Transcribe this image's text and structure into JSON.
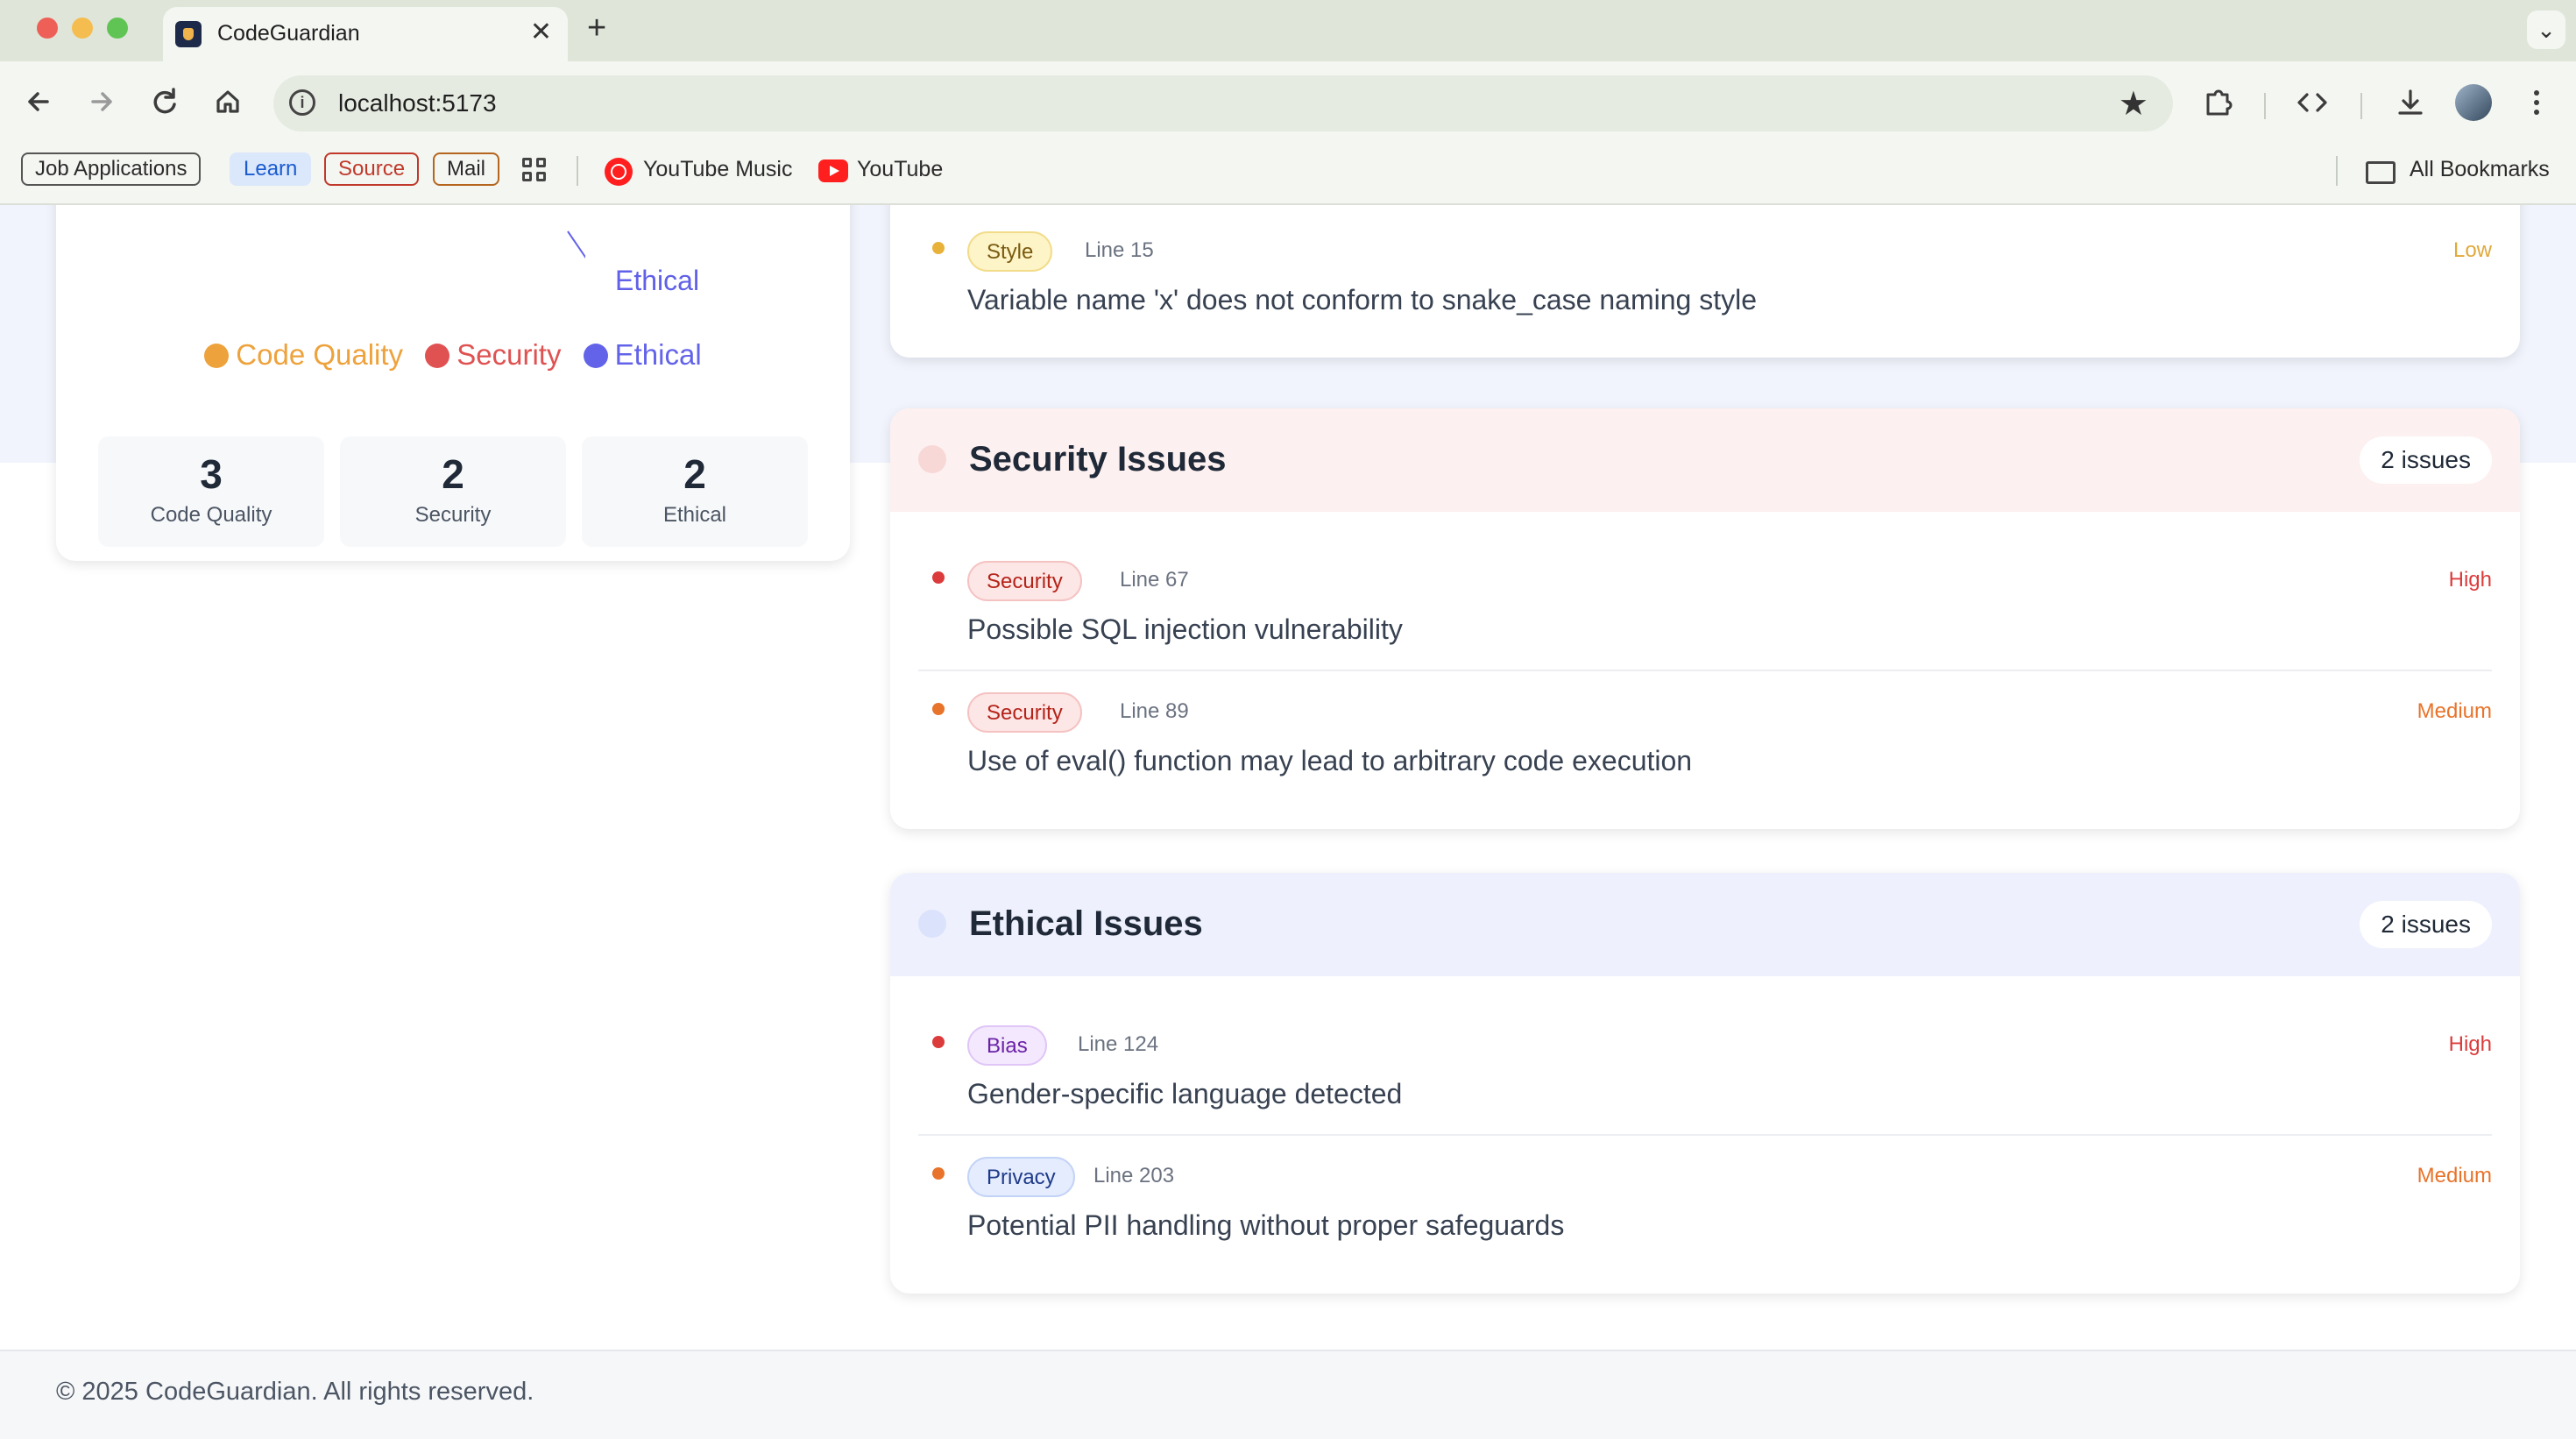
{
  "browser": {
    "tab_title": "CodeGuardian",
    "tab_close": "✕",
    "new_tab": "+",
    "tab_menu": "⌄",
    "url": "localhost:5173",
    "bookmarks": {
      "job_applications": "Job Applications",
      "learn": "Learn",
      "source": "Source",
      "mail": "Mail",
      "youtube_music": "YouTube Music",
      "youtube": "YouTube",
      "all_bookmarks": "All Bookmarks"
    }
  },
  "summary": {
    "chart_data": {
      "type": "pie",
      "categories": [
        "Code Quality",
        "Security",
        "Ethical"
      ],
      "values": [
        3,
        2,
        2
      ],
      "colors": [
        "#eea23c",
        "#e05252",
        "#6363ea"
      ],
      "visible_slice_label": "Ethical"
    },
    "legend": [
      {
        "label": "Code Quality",
        "color": "#eea23c"
      },
      {
        "label": "Security",
        "color": "#e05252"
      },
      {
        "label": "Ethical",
        "color": "#6363ea"
      }
    ],
    "stats": [
      {
        "value": "3",
        "label": "Code Quality"
      },
      {
        "value": "2",
        "label": "Security"
      },
      {
        "value": "2",
        "label": "Ethical"
      }
    ]
  },
  "code_quality_partial": {
    "issue": {
      "tag": "Style",
      "line": "Line 15",
      "severity": "Low",
      "severity_color": "#e0a93a",
      "dot_color": "#e8b23a",
      "text": "Variable name 'x' does not conform to snake_case naming style"
    }
  },
  "security_section": {
    "title": "Security Issues",
    "count": "2 issues",
    "header_bg": "#fdf0f0",
    "header_dot": "#f8d7d7",
    "issues": [
      {
        "tag": "Security",
        "line": "Line 67",
        "severity": "High",
        "severity_color": "#dc3b3b",
        "dot_color": "#dc3b3b",
        "text": "Possible SQL injection vulnerability"
      },
      {
        "tag": "Security",
        "line": "Line 89",
        "severity": "Medium",
        "severity_color": "#e8732a",
        "dot_color": "#e8732a",
        "text": "Use of eval() function may lead to arbitrary code execution"
      }
    ]
  },
  "ethical_section": {
    "title": "Ethical Issues",
    "count": "2 issues",
    "header_bg": "#eef1fd",
    "header_dot": "#dbe2fb",
    "issues": [
      {
        "tag": "Bias",
        "line": "Line 124",
        "severity": "High",
        "severity_color": "#dc3b3b",
        "dot_color": "#dc3b3b",
        "text": "Gender-specific language detected"
      },
      {
        "tag": "Privacy",
        "line": "Line 203",
        "severity": "Medium",
        "severity_color": "#e8732a",
        "dot_color": "#e8732a",
        "text": "Potential PII handling without proper safeguards"
      }
    ]
  },
  "footer": {
    "text": "© 2025 CodeGuardian. All rights reserved."
  }
}
